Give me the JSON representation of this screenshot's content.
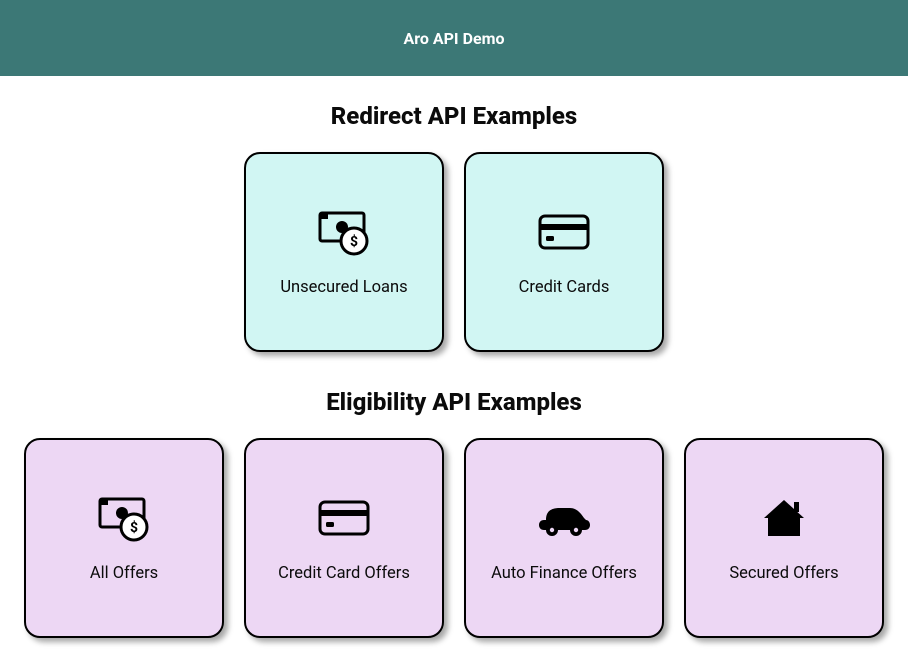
{
  "header": {
    "title": "Aro API Demo"
  },
  "sections": {
    "redirect": {
      "title": "Redirect API Examples",
      "cards": [
        {
          "label": "Unsecured Loans",
          "icon": "money-icon"
        },
        {
          "label": "Credit Cards",
          "icon": "credit-card-icon"
        }
      ]
    },
    "eligibility": {
      "title": "Eligibility API Examples",
      "cards": [
        {
          "label": "All Offers",
          "icon": "money-icon"
        },
        {
          "label": "Credit Card Offers",
          "icon": "credit-card-icon"
        },
        {
          "label": "Auto Finance Offers",
          "icon": "car-icon"
        },
        {
          "label": "Secured Offers",
          "icon": "home-icon"
        }
      ]
    }
  },
  "colors": {
    "headerBg": "#3c7876",
    "redirectCard": "#d1f6f3",
    "eligibilityCard": "#edd7f4"
  }
}
